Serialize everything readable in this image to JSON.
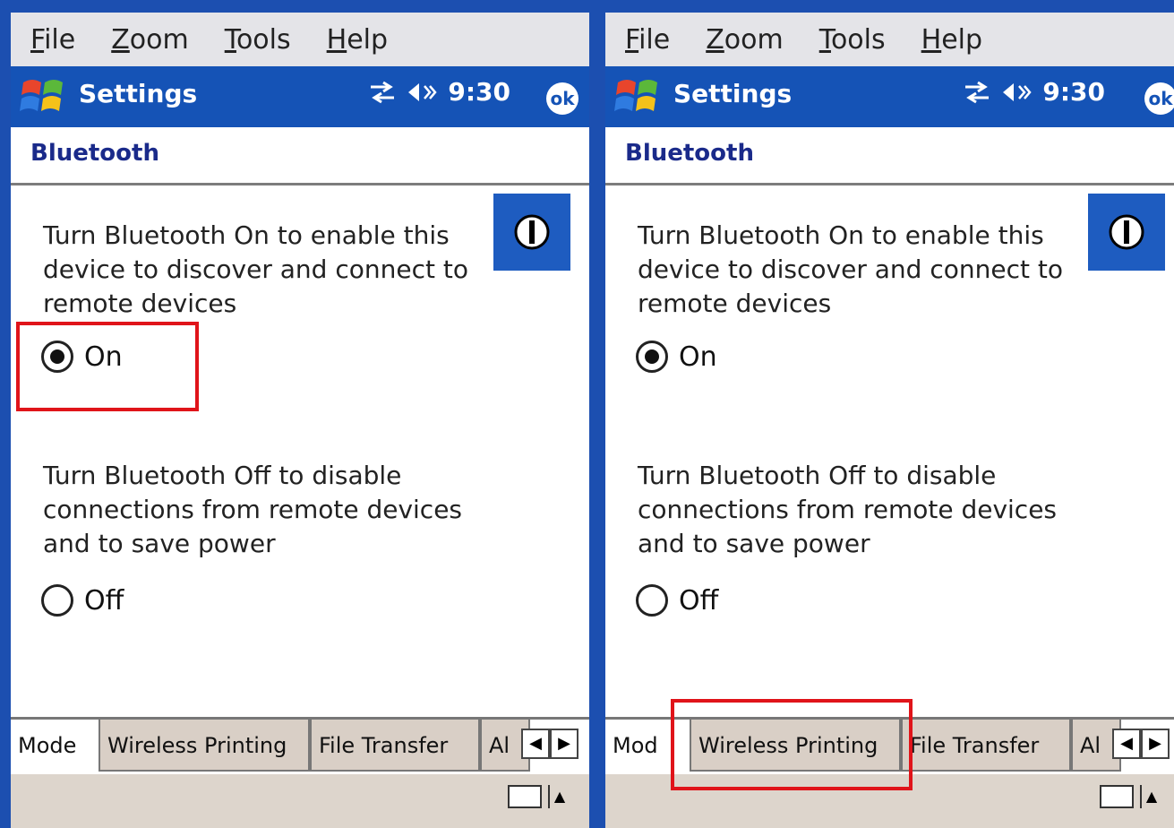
{
  "menu": [
    "File",
    "Zoom",
    "Tools",
    "Help"
  ],
  "menu_underline": [
    "F",
    "Z",
    "T",
    "H"
  ],
  "titlebar": {
    "title": "Settings",
    "time": "9:30",
    "ok": "ok"
  },
  "header": "Bluetooth",
  "on_description": "Turn Bluetooth On to enable this device to discover and connect to remote devices",
  "on_label": "On",
  "off_description": "Turn Bluetooth Off to disable connections from remote devices and to save power",
  "off_label": "Off",
  "tabs": [
    "Mode",
    "Wireless Printing",
    "File Transfer",
    "Al"
  ],
  "tabs_b": [
    "Mod",
    "Wireless Printing",
    "File Transfer",
    "Al"
  ],
  "icons": {
    "windows": "windows-start-icon",
    "connectivity": "connectivity-arrows-icon",
    "volume": "volume-icon",
    "power": "power-icon",
    "keyboard": "keyboard-icon"
  },
  "colors": {
    "titlebar": "#1553b6",
    "highlight": "#e0141a",
    "tab_bg": "#d9cfc6"
  },
  "selected": "On"
}
